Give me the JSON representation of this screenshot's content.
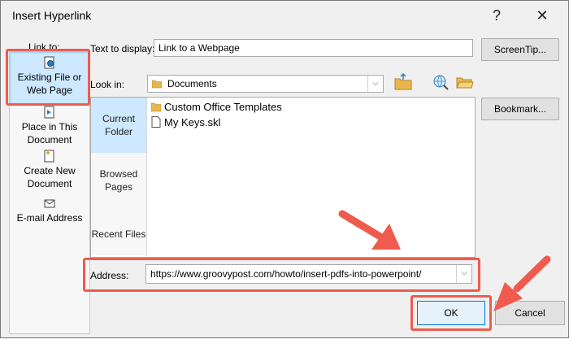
{
  "window": {
    "title": "Insert Hyperlink",
    "help_glyph": "?",
    "close_glyph": "✕"
  },
  "link_to": {
    "label": "Link to:",
    "items": [
      {
        "label_line1": "Existing File or",
        "label_line2": "Web Page",
        "icon": "existing-file-icon"
      },
      {
        "label_line1": "Place in This",
        "label_line2": "Document",
        "icon": "place-in-document-icon"
      },
      {
        "label_line1": "Create New",
        "label_line2": "Document",
        "icon": "new-document-icon"
      },
      {
        "label_line1": "E-mail Address",
        "label_line2": "",
        "icon": "email-icon"
      }
    ]
  },
  "text_to_display": {
    "label": "Text to display:",
    "value": "Link to a Webpage"
  },
  "screentip_button": "ScreenTip...",
  "look_in": {
    "label": "Look in:",
    "value": "Documents"
  },
  "browse_nav": [
    {
      "line1": "Current",
      "line2": "Folder"
    },
    {
      "line1": "Browsed",
      "line2": "Pages"
    },
    {
      "line1": "Recent Files",
      "line2": ""
    }
  ],
  "files": [
    {
      "name": "Custom Office Templates",
      "icon": "folder-icon"
    },
    {
      "name": "My Keys.skl",
      "icon": "file-icon"
    }
  ],
  "bookmark_button": "Bookmark...",
  "address": {
    "label": "Address:",
    "value": "https://www.groovypost.com/howto/insert-pdfs-into-powerpoint/"
  },
  "ok_button": "OK",
  "cancel_button": "Cancel",
  "colors": {
    "highlight": "#ef5b4f",
    "selection": "#cde8ff"
  }
}
